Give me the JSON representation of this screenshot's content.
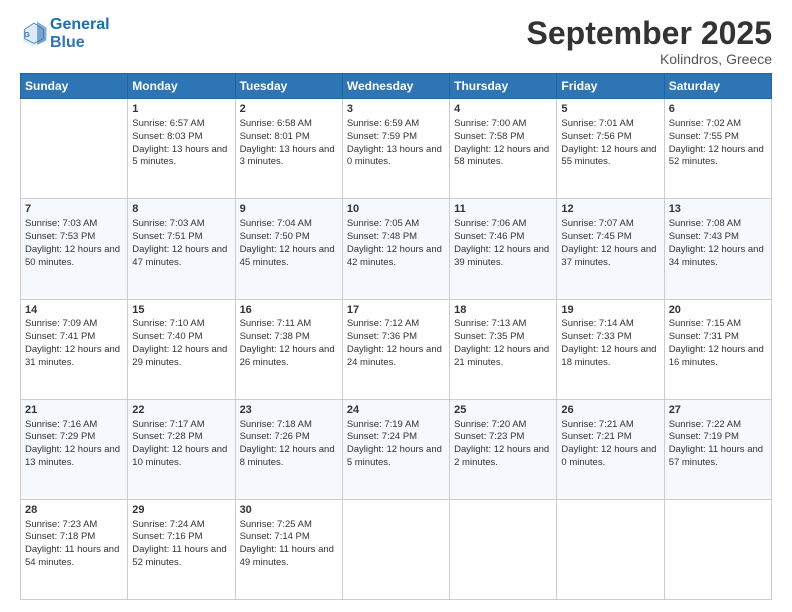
{
  "logo": {
    "line1": "General",
    "line2": "Blue"
  },
  "title": "September 2025",
  "subtitle": "Kolindros, Greece",
  "days": [
    "Sunday",
    "Monday",
    "Tuesday",
    "Wednesday",
    "Thursday",
    "Friday",
    "Saturday"
  ],
  "weeks": [
    [
      {
        "day": "",
        "sunrise": "",
        "sunset": "",
        "daylight": ""
      },
      {
        "day": "1",
        "sunrise": "Sunrise: 6:57 AM",
        "sunset": "Sunset: 8:03 PM",
        "daylight": "Daylight: 13 hours and 5 minutes."
      },
      {
        "day": "2",
        "sunrise": "Sunrise: 6:58 AM",
        "sunset": "Sunset: 8:01 PM",
        "daylight": "Daylight: 13 hours and 3 minutes."
      },
      {
        "day": "3",
        "sunrise": "Sunrise: 6:59 AM",
        "sunset": "Sunset: 7:59 PM",
        "daylight": "Daylight: 13 hours and 0 minutes."
      },
      {
        "day": "4",
        "sunrise": "Sunrise: 7:00 AM",
        "sunset": "Sunset: 7:58 PM",
        "daylight": "Daylight: 12 hours and 58 minutes."
      },
      {
        "day": "5",
        "sunrise": "Sunrise: 7:01 AM",
        "sunset": "Sunset: 7:56 PM",
        "daylight": "Daylight: 12 hours and 55 minutes."
      },
      {
        "day": "6",
        "sunrise": "Sunrise: 7:02 AM",
        "sunset": "Sunset: 7:55 PM",
        "daylight": "Daylight: 12 hours and 52 minutes."
      }
    ],
    [
      {
        "day": "7",
        "sunrise": "Sunrise: 7:03 AM",
        "sunset": "Sunset: 7:53 PM",
        "daylight": "Daylight: 12 hours and 50 minutes."
      },
      {
        "day": "8",
        "sunrise": "Sunrise: 7:03 AM",
        "sunset": "Sunset: 7:51 PM",
        "daylight": "Daylight: 12 hours and 47 minutes."
      },
      {
        "day": "9",
        "sunrise": "Sunrise: 7:04 AM",
        "sunset": "Sunset: 7:50 PM",
        "daylight": "Daylight: 12 hours and 45 minutes."
      },
      {
        "day": "10",
        "sunrise": "Sunrise: 7:05 AM",
        "sunset": "Sunset: 7:48 PM",
        "daylight": "Daylight: 12 hours and 42 minutes."
      },
      {
        "day": "11",
        "sunrise": "Sunrise: 7:06 AM",
        "sunset": "Sunset: 7:46 PM",
        "daylight": "Daylight: 12 hours and 39 minutes."
      },
      {
        "day": "12",
        "sunrise": "Sunrise: 7:07 AM",
        "sunset": "Sunset: 7:45 PM",
        "daylight": "Daylight: 12 hours and 37 minutes."
      },
      {
        "day": "13",
        "sunrise": "Sunrise: 7:08 AM",
        "sunset": "Sunset: 7:43 PM",
        "daylight": "Daylight: 12 hours and 34 minutes."
      }
    ],
    [
      {
        "day": "14",
        "sunrise": "Sunrise: 7:09 AM",
        "sunset": "Sunset: 7:41 PM",
        "daylight": "Daylight: 12 hours and 31 minutes."
      },
      {
        "day": "15",
        "sunrise": "Sunrise: 7:10 AM",
        "sunset": "Sunset: 7:40 PM",
        "daylight": "Daylight: 12 hours and 29 minutes."
      },
      {
        "day": "16",
        "sunrise": "Sunrise: 7:11 AM",
        "sunset": "Sunset: 7:38 PM",
        "daylight": "Daylight: 12 hours and 26 minutes."
      },
      {
        "day": "17",
        "sunrise": "Sunrise: 7:12 AM",
        "sunset": "Sunset: 7:36 PM",
        "daylight": "Daylight: 12 hours and 24 minutes."
      },
      {
        "day": "18",
        "sunrise": "Sunrise: 7:13 AM",
        "sunset": "Sunset: 7:35 PM",
        "daylight": "Daylight: 12 hours and 21 minutes."
      },
      {
        "day": "19",
        "sunrise": "Sunrise: 7:14 AM",
        "sunset": "Sunset: 7:33 PM",
        "daylight": "Daylight: 12 hours and 18 minutes."
      },
      {
        "day": "20",
        "sunrise": "Sunrise: 7:15 AM",
        "sunset": "Sunset: 7:31 PM",
        "daylight": "Daylight: 12 hours and 16 minutes."
      }
    ],
    [
      {
        "day": "21",
        "sunrise": "Sunrise: 7:16 AM",
        "sunset": "Sunset: 7:29 PM",
        "daylight": "Daylight: 12 hours and 13 minutes."
      },
      {
        "day": "22",
        "sunrise": "Sunrise: 7:17 AM",
        "sunset": "Sunset: 7:28 PM",
        "daylight": "Daylight: 12 hours and 10 minutes."
      },
      {
        "day": "23",
        "sunrise": "Sunrise: 7:18 AM",
        "sunset": "Sunset: 7:26 PM",
        "daylight": "Daylight: 12 hours and 8 minutes."
      },
      {
        "day": "24",
        "sunrise": "Sunrise: 7:19 AM",
        "sunset": "Sunset: 7:24 PM",
        "daylight": "Daylight: 12 hours and 5 minutes."
      },
      {
        "day": "25",
        "sunrise": "Sunrise: 7:20 AM",
        "sunset": "Sunset: 7:23 PM",
        "daylight": "Daylight: 12 hours and 2 minutes."
      },
      {
        "day": "26",
        "sunrise": "Sunrise: 7:21 AM",
        "sunset": "Sunset: 7:21 PM",
        "daylight": "Daylight: 12 hours and 0 minutes."
      },
      {
        "day": "27",
        "sunrise": "Sunrise: 7:22 AM",
        "sunset": "Sunset: 7:19 PM",
        "daylight": "Daylight: 11 hours and 57 minutes."
      }
    ],
    [
      {
        "day": "28",
        "sunrise": "Sunrise: 7:23 AM",
        "sunset": "Sunset: 7:18 PM",
        "daylight": "Daylight: 11 hours and 54 minutes."
      },
      {
        "day": "29",
        "sunrise": "Sunrise: 7:24 AM",
        "sunset": "Sunset: 7:16 PM",
        "daylight": "Daylight: 11 hours and 52 minutes."
      },
      {
        "day": "30",
        "sunrise": "Sunrise: 7:25 AM",
        "sunset": "Sunset: 7:14 PM",
        "daylight": "Daylight: 11 hours and 49 minutes."
      },
      {
        "day": "",
        "sunrise": "",
        "sunset": "",
        "daylight": ""
      },
      {
        "day": "",
        "sunrise": "",
        "sunset": "",
        "daylight": ""
      },
      {
        "day": "",
        "sunrise": "",
        "sunset": "",
        "daylight": ""
      },
      {
        "day": "",
        "sunrise": "",
        "sunset": "",
        "daylight": ""
      }
    ]
  ]
}
